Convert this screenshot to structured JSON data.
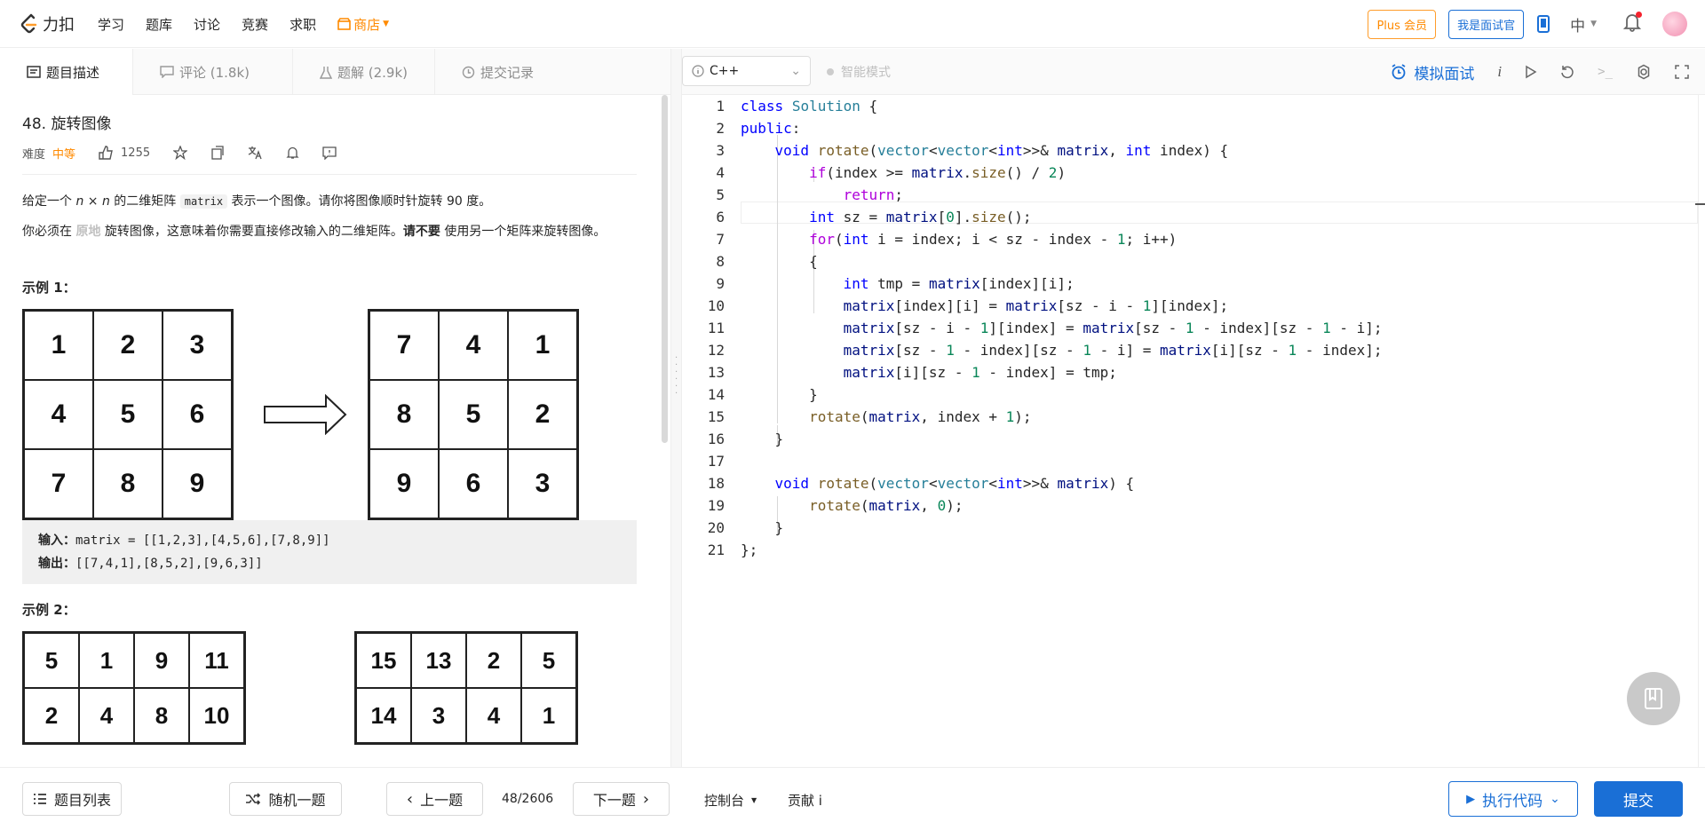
{
  "header": {
    "logo_text": "力扣",
    "nav": [
      "学习",
      "题库",
      "讨论",
      "竞赛",
      "求职"
    ],
    "shop": "商店",
    "plus": "Plus 会员",
    "interviewer": "我是面试官",
    "lang": "中"
  },
  "left_tabs": [
    {
      "label": "题目描述",
      "icon": "description-icon"
    },
    {
      "label": "评论 (1.8k)",
      "icon": "comment-icon"
    },
    {
      "label": "题解 (2.9k)",
      "icon": "flask-icon"
    },
    {
      "label": "提交记录",
      "icon": "clock-icon"
    }
  ],
  "problem": {
    "title": "48. 旋转图像",
    "difficulty_label": "难度",
    "difficulty": "中等",
    "likes": "1255",
    "p1_a": "给定一个 ",
    "p1_n": "n × n",
    "p1_b": " 的二维矩阵 ",
    "p1_code": "matrix",
    "p1_c": " 表示一个图像。请你将图像顺时针旋转 90 度。",
    "p2_a": "你必须在 ",
    "p2_hl": "原地",
    "p2_b": " 旋转图像，这意味着你需要直接修改输入的二维矩阵。",
    "p2_bold": "请不要",
    "p2_c": " 使用另一个矩阵来旋转图像。",
    "example1_title": "示例 1：",
    "example1_in_grid": [
      "1",
      "2",
      "3",
      "4",
      "5",
      "6",
      "7",
      "8",
      "9"
    ],
    "example1_out_grid": [
      "7",
      "4",
      "1",
      "8",
      "5",
      "2",
      "9",
      "6",
      "3"
    ],
    "input_label": "输入：",
    "input_value": "matrix = [[1,2,3],[4,5,6],[7,8,9]]",
    "output_label": "输出：",
    "output_value": "[[7,4,1],[8,5,2],[9,6,3]]",
    "example2_title": "示例 2：",
    "example2_in_grid": [
      "5",
      "1",
      "9",
      "11",
      "2",
      "4",
      "8",
      "10"
    ],
    "example2_out_grid": [
      "15",
      "13",
      "2",
      "5",
      "14",
      "3",
      "4",
      "1"
    ]
  },
  "editor": {
    "language": "C++",
    "smart_mode": "智能模式",
    "mock_interview": "模拟面试"
  },
  "code_lines": [
    "class Solution {",
    "public:",
    "    void rotate(vector<vector<int>>& matrix, int index) {",
    "        if(index >= matrix.size() / 2)",
    "            return;",
    "        int sz = matrix[0].size();",
    "        for(int i = index; i < sz - index - 1; i++)",
    "        {",
    "            int tmp = matrix[index][i];",
    "            matrix[index][i] = matrix[sz - i - 1][index];",
    "            matrix[sz - i - 1][index] = matrix[sz - 1 - index][sz - 1 - i];",
    "            matrix[sz - 1 - index][sz - 1 - i] = matrix[i][sz - 1 - index];",
    "            matrix[i][sz - 1 - index] = tmp;",
    "        }",
    "        rotate(matrix, index + 1);",
    "    }",
    "",
    "    void rotate(vector<vector<int>>& matrix) {",
    "        rotate(matrix, 0);",
    "    }",
    "};"
  ],
  "bottom": {
    "problem_list": "题目列表",
    "random": "随机一题",
    "prev": "上一题",
    "pager": "48/2606",
    "next": "下一题",
    "console": "控制台",
    "contribute": "贡献 i",
    "run": "执行代码",
    "submit": "提交"
  }
}
